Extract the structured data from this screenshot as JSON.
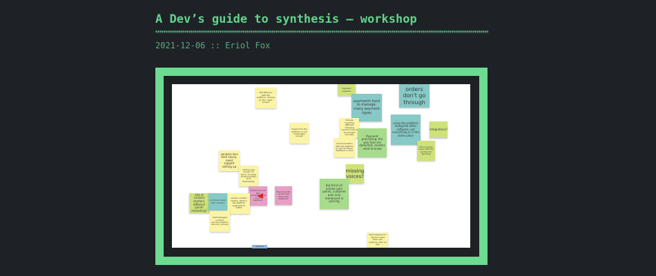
{
  "post": {
    "title": "A Dev’s guide to synthesis – workshop",
    "date": "2021-12-06",
    "separator": "::",
    "author": "Eriol Fox"
  },
  "board": {
    "notes": {
      "n1": "Not fitting in with the platform, looking for the 'right' project",
      "n2": "migration systems",
      "n3": "payments hard to manage, many payment types",
      "n4": "orders don't go through",
      "n5": "Support for the platform is not sustainable enough",
      "n6": "Change handling different changing vendors, has to be handled manually",
      "n7": "Payment processing, the way fees are deducted, vendors need to know",
      "n8": "using the platform alongside other software, not everything is in the same place",
      "n9": "integrations?",
      "n10": "Communication with the platform is hard to follow, feedback is slow",
      "n11": "Many people share with the vendors for reporting",
      "n12": "vendors less tech savvy, need support setting up",
      "n13": "Adding new vendor for stock, increase of having them do it themselves",
      "n14": "missing voices?",
      "n15": "big focus on vendor pain points, customer pain only mentioned in passing",
      "n16": "Vendors do not feel connected, not much feedback",
      "n17": "Vendors don't know what the platform can do",
      "n18": "How does the vendor feel about the platform?",
      "n19": "lots of content vendors, different points marketing?",
      "n20": "Communication with vendors",
      "n21": "vendor content hidden, what is the platform supposed to fulfill?",
      "n22": "Self-managed content, synchronisation, security, privacy",
      "n23": "Split experience: vendors have their own systems, then an app",
      "n24": "Vendors"
    }
  },
  "colors": {
    "background": "#1e2227",
    "accent": "#63d38c",
    "frame": "#6edb93",
    "note_yellow": "#fbf4a5",
    "note_teal": "#86c9c6",
    "note_green": "#a7dc8c",
    "note_pink": "#e79ec4",
    "note_lime": "#cfe27a",
    "note_blue": "#8db6e6",
    "arrow": "#d12a2a"
  }
}
